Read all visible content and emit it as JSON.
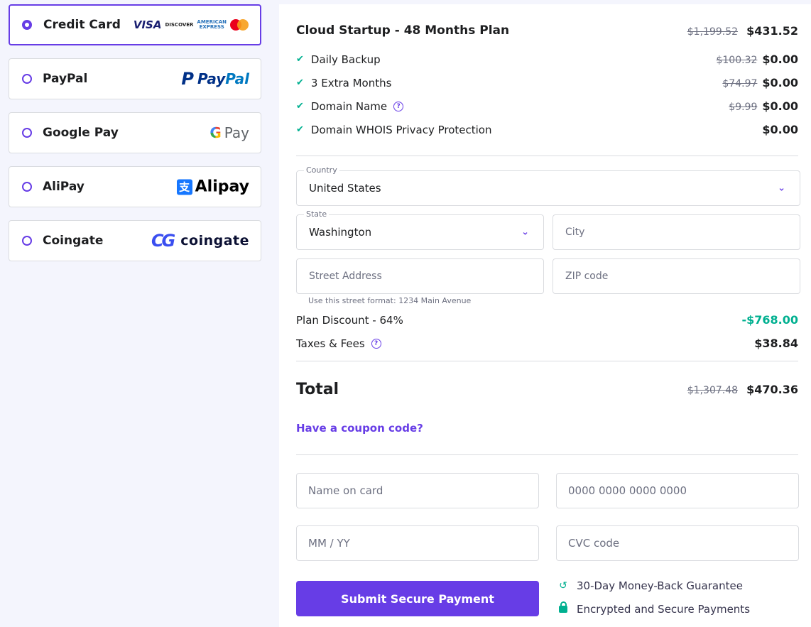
{
  "payment_methods": [
    {
      "label": "Credit Card",
      "selected": true,
      "logo": "card-networks"
    },
    {
      "label": "PayPal",
      "selected": false,
      "logo": "paypal-logo"
    },
    {
      "label": "Google Pay",
      "selected": false,
      "logo": "google-pay-logo"
    },
    {
      "label": "AliPay",
      "selected": false,
      "logo": "alipay-logo"
    },
    {
      "label": "Coingate",
      "selected": false,
      "logo": "coingate-logo"
    }
  ],
  "logos": {
    "visa": "VISA",
    "discover": "DISCOVER",
    "amex_1": "AMERICAN",
    "amex_2": "EXPRESS",
    "paypal_1": "Pay",
    "paypal_2": "Pal",
    "gpay_g": "G",
    "gpay_text": "Pay",
    "alipay_mark": "支",
    "alipay_text": "Alipay",
    "coingate_mark": "CG",
    "coingate_text": "coingate"
  },
  "plan": {
    "title": "Cloud Startup - 48 Months Plan",
    "old_price": "$1,199.52",
    "price": "$431.52"
  },
  "items": [
    {
      "label": "Daily Backup",
      "old_price": "$100.32",
      "price": "$0.00",
      "help": false
    },
    {
      "label": "3 Extra Months",
      "old_price": "$74.97",
      "price": "$0.00",
      "help": false
    },
    {
      "label": "Domain Name",
      "old_price": "$9.99",
      "price": "$0.00",
      "help": true
    },
    {
      "label": "Domain WHOIS Privacy Protection",
      "old_price": "",
      "price": "$0.00",
      "help": false
    }
  ],
  "address": {
    "country_label": "Country",
    "country_value": "United States",
    "state_label": "State",
    "state_value": "Washington",
    "city_placeholder": "City",
    "street_placeholder": "Street Address",
    "zip_placeholder": "ZIP code",
    "street_hint": "Use this street format: 1234 Main Avenue"
  },
  "summary": {
    "discount_label": "Plan Discount - 64%",
    "discount_value": "-$768.00",
    "taxes_label": "Taxes & Fees",
    "taxes_value": "$38.84",
    "total_label": "Total",
    "total_old": "$1,307.48",
    "total_value": "$470.36",
    "coupon_link": "Have a coupon code?"
  },
  "card": {
    "name_placeholder": "Name on card",
    "number_placeholder": "0000 0000 0000 0000",
    "expiry_placeholder": "MM / YY",
    "cvc_placeholder": "CVC code",
    "submit_label": "Submit Secure Payment"
  },
  "assurances": {
    "guarantee": "30-Day Money-Back Guarantee",
    "secure": "Encrypted and Secure Payments"
  },
  "colors": {
    "accent": "#673de6",
    "success": "#00b090",
    "background": "#f4f5fd"
  }
}
